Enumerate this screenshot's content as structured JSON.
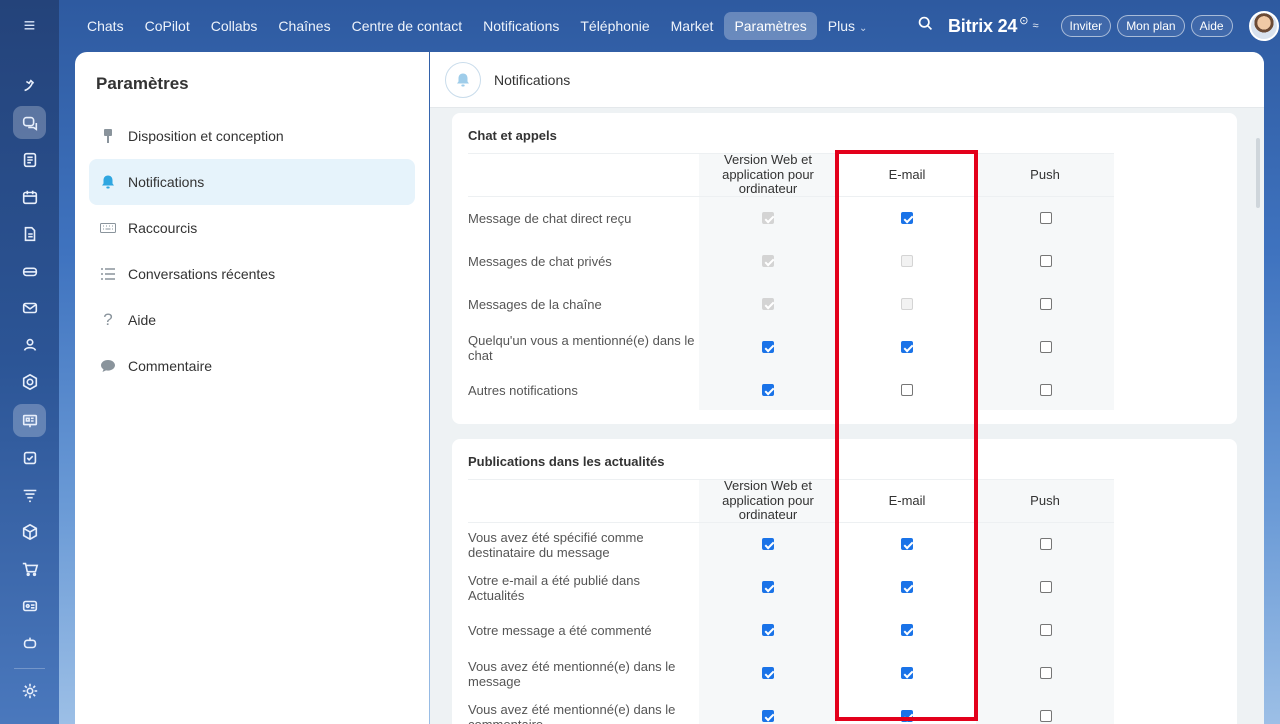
{
  "nav": {
    "tabs": [
      {
        "label": "Chats",
        "active": false
      },
      {
        "label": "CoPilot",
        "active": false
      },
      {
        "label": "Collabs",
        "active": false
      },
      {
        "label": "Chaînes",
        "active": false
      },
      {
        "label": "Centre de contact",
        "active": false
      },
      {
        "label": "Notifications",
        "active": false
      },
      {
        "label": "Téléphonie",
        "active": false
      },
      {
        "label": "Market",
        "active": false
      },
      {
        "label": "Paramètres",
        "active": true
      }
    ],
    "more_label": "Plus"
  },
  "header": {
    "brand": "Bitrix 24",
    "brand_mark": "⊙",
    "brand_switch": "≈",
    "invite_label": "Inviter",
    "plan_label": "Mon plan",
    "help_label": "Aide"
  },
  "settings": {
    "title": "Paramètres",
    "items": [
      {
        "label": "Disposition et conception",
        "icon": "brush-icon",
        "active": false
      },
      {
        "label": "Notifications",
        "icon": "bell-icon",
        "active": true
      },
      {
        "label": "Raccourcis",
        "icon": "keyboard-icon",
        "active": false
      },
      {
        "label": "Conversations récentes",
        "icon": "list-icon",
        "active": false
      },
      {
        "label": "Aide",
        "icon": "question-icon",
        "active": false
      },
      {
        "label": "Commentaire",
        "icon": "comment-icon",
        "active": false
      }
    ]
  },
  "main": {
    "title": "Notifications",
    "columns": [
      "Version Web et application pour ordinateur",
      "E-mail",
      "Push"
    ],
    "sections": [
      {
        "title": "Chat et appels",
        "rows": [
          {
            "label": "Message de chat direct reçu",
            "web": "disabled-on",
            "email": "on",
            "push": "off"
          },
          {
            "label": "Messages de chat privés",
            "web": "disabled-on",
            "email": "disabled",
            "push": "off"
          },
          {
            "label": "Messages de la chaîne",
            "web": "disabled-on",
            "email": "disabled",
            "push": "off"
          },
          {
            "label": "Quelqu'un vous a mentionné(e) dans le chat",
            "web": "on",
            "email": "on",
            "push": "off"
          },
          {
            "label": "Autres notifications",
            "web": "on",
            "email": "off",
            "push": "off"
          }
        ]
      },
      {
        "title": "Publications dans les actualités",
        "rows": [
          {
            "label": "Vous avez été spécifié comme destinataire du message",
            "web": "on",
            "email": "on",
            "push": "off"
          },
          {
            "label": "Votre e-mail a été publié dans Actualités",
            "web": "on",
            "email": "on",
            "push": "off"
          },
          {
            "label": "Votre message a été commenté",
            "web": "on",
            "email": "on",
            "push": "off"
          },
          {
            "label": "Vous avez été mentionné(e) dans le message",
            "web": "on",
            "email": "on",
            "push": "off"
          },
          {
            "label": "Vous avez été mentionné(e) dans le commentaire",
            "web": "on",
            "email": "on",
            "push": "off"
          }
        ]
      }
    ]
  },
  "colors": {
    "accent": "#1a73e8",
    "highlight": "#e3001b",
    "active_menu_bg": "#e6f3fb"
  }
}
